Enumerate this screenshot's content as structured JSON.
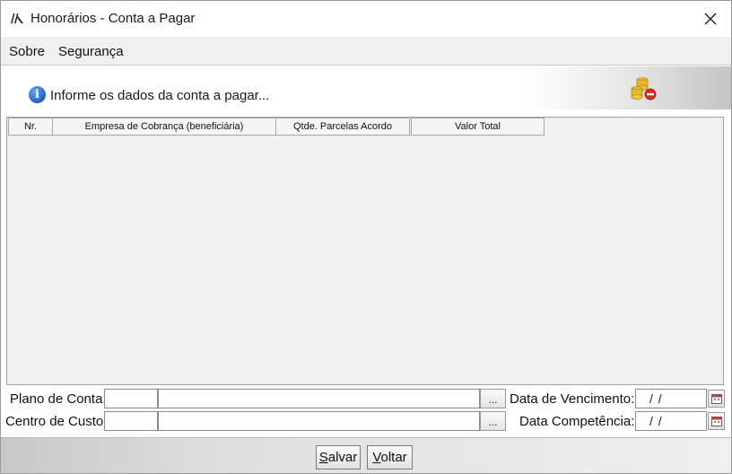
{
  "window": {
    "title": "Honorários - Conta a Pagar"
  },
  "menu": {
    "items": [
      "Sobre",
      "Segurança"
    ]
  },
  "banner": {
    "text": "Informe os dados da conta a pagar..."
  },
  "table": {
    "columns": [
      "Nr.",
      "Empresa de Cobrança (beneficiária)",
      "Qtde. Parcelas Acordo",
      "Valor Total"
    ],
    "rows": []
  },
  "form": {
    "plano_label": "Plano de Conta:",
    "plano_code": "",
    "plano_desc": "",
    "centro_label": "Centro de Custo:",
    "centro_code": "",
    "centro_desc": "",
    "browse_label": "...",
    "vencimento_label": "Data de Vencimento:",
    "vencimento_value": "/ /",
    "competencia_label": "Data Competência:",
    "competencia_value": "/ /"
  },
  "buttons": {
    "save": {
      "accel": "S",
      "rest": "alvar"
    },
    "back": {
      "accel": "V",
      "rest": "oltar"
    }
  },
  "colors": {
    "info": "#1f5fc4",
    "coins": "#e0b020",
    "stop": "#d23020"
  }
}
